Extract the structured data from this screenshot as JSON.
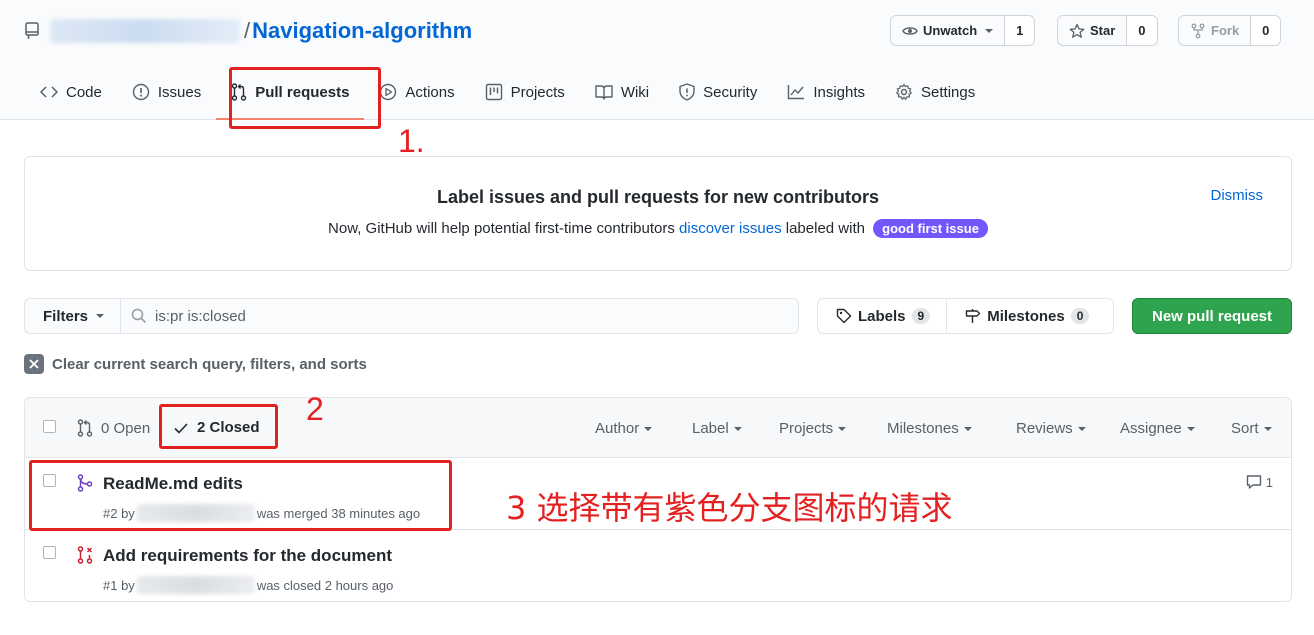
{
  "repo": {
    "name": "Navigation-algorithm",
    "slash": "/"
  },
  "header_actions": {
    "watch": {
      "label": "Unwatch",
      "count": "1"
    },
    "star": {
      "label": "Star",
      "count": "0"
    },
    "fork": {
      "label": "Fork",
      "count": "0"
    }
  },
  "tabs": [
    {
      "label": "Code",
      "icon": "code-icon"
    },
    {
      "label": "Issues",
      "icon": "issue-icon"
    },
    {
      "label": "Pull requests",
      "icon": "pull-request-icon",
      "active": true
    },
    {
      "label": "Actions",
      "icon": "play-icon"
    },
    {
      "label": "Projects",
      "icon": "project-icon"
    },
    {
      "label": "Wiki",
      "icon": "book-icon"
    },
    {
      "label": "Security",
      "icon": "shield-icon"
    },
    {
      "label": "Insights",
      "icon": "graph-icon"
    },
    {
      "label": "Settings",
      "icon": "gear-icon"
    }
  ],
  "banner": {
    "title": "Label issues and pull requests for new contributors",
    "text_before": "Now, GitHub will help potential first-time contributors ",
    "link": "discover issues",
    "text_after": " labeled with",
    "label": "good first issue",
    "dismiss": "Dismiss"
  },
  "filters": {
    "button": "Filters",
    "query": "is:pr is:closed"
  },
  "labels_btn": {
    "label": "Labels",
    "count": "9"
  },
  "milestones_btn": {
    "label": "Milestones",
    "count": "0"
  },
  "new_pr": "New pull request",
  "clear": "Clear current search query, filters, and sorts",
  "list_header": {
    "open": "0 Open",
    "closed": "2 Closed",
    "filters": [
      "Author",
      "Label",
      "Projects",
      "Milestones",
      "Reviews",
      "Assignee",
      "Sort"
    ]
  },
  "pull_requests": [
    {
      "title": "ReadMe.md edits",
      "number": "#2 by",
      "status": "was merged 38 minutes ago",
      "state": "merged",
      "comments": "1"
    },
    {
      "title": "Add requirements for the document",
      "number": "#1 by",
      "status": "was closed 2 hours ago",
      "state": "closed"
    }
  ],
  "annotations": {
    "step1": "1.",
    "step2": "2",
    "step3": "3 选择带有紫色分支图标的请求",
    "color": "#e32121"
  },
  "colors": {
    "link": "#0366d6",
    "green": "#2ea44f",
    "merged": "#6f42c1",
    "closed": "#cb2431",
    "label_purple": "#7057ff"
  }
}
